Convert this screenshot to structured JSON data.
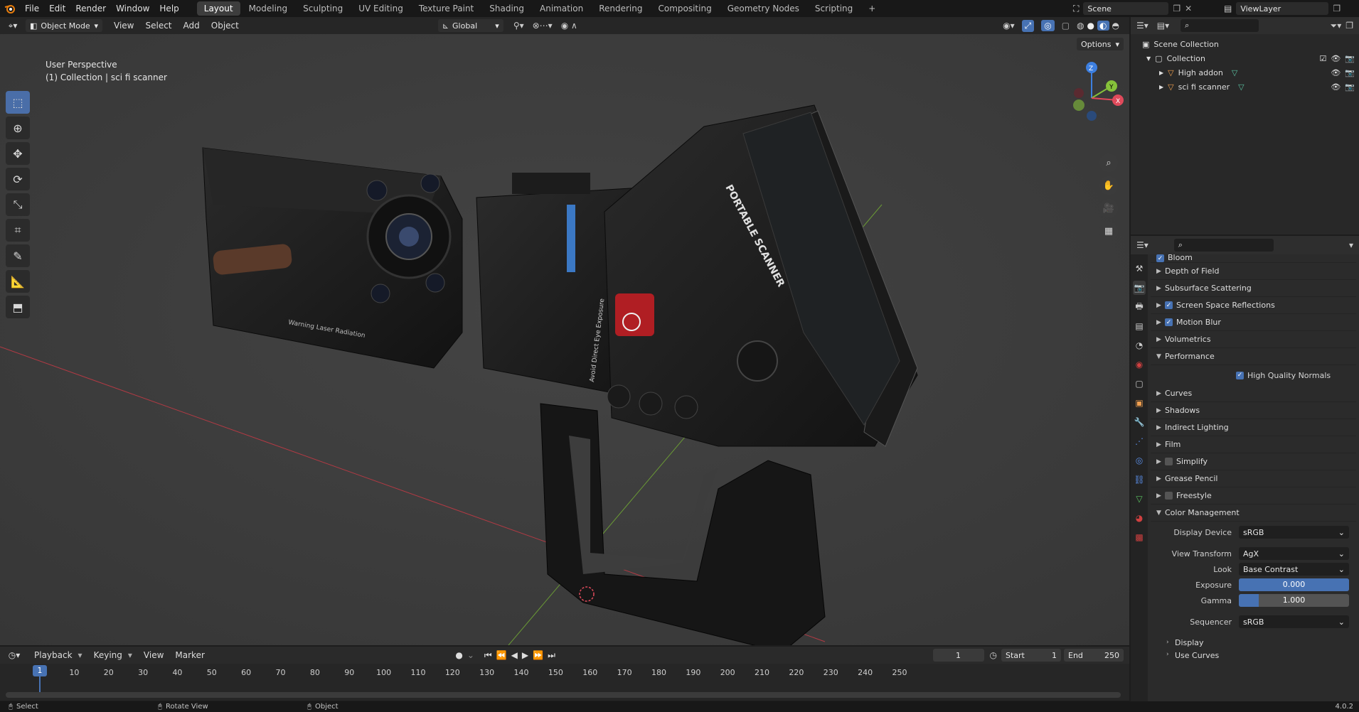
{
  "topbar": {
    "menus": [
      "File",
      "Edit",
      "Render",
      "Window",
      "Help"
    ],
    "workspaces": [
      "Layout",
      "Modeling",
      "Sculpting",
      "UV Editing",
      "Texture Paint",
      "Shading",
      "Animation",
      "Rendering",
      "Compositing",
      "Geometry Nodes",
      "Scripting"
    ],
    "active_workspace": "Layout",
    "add_tab": "+",
    "scene": "Scene",
    "view_layer": "ViewLayer"
  },
  "viewport_header": {
    "mode": "Object Mode",
    "menus": [
      "View",
      "Select",
      "Add",
      "Object"
    ],
    "orientation": "Global",
    "options": "Options"
  },
  "viewport": {
    "perspective": "User Perspective",
    "collection_info": "(1) Collection | sci fi scanner",
    "axes": {
      "x": "X",
      "y": "Y",
      "z": "Z"
    },
    "model": {
      "brand_text": "PORTABLE SCANNER",
      "side_text": "Avoid Direct Eye Exposure",
      "warning_text": "Warning Laser Radiation"
    }
  },
  "outliner": {
    "root": "Scene Collection",
    "collection": "Collection",
    "items": [
      {
        "label": "High addon"
      },
      {
        "label": "sci fi scanner"
      }
    ]
  },
  "properties": {
    "partial_top": "Bloom",
    "panels": [
      {
        "label": "Depth of Field",
        "checkbox": null
      },
      {
        "label": "Subsurface Scattering",
        "checkbox": null
      },
      {
        "label": "Screen Space Reflections",
        "checkbox": true
      },
      {
        "label": "Motion Blur",
        "checkbox": true
      },
      {
        "label": "Volumetrics",
        "checkbox": null
      }
    ],
    "performance": {
      "label": "Performance",
      "option": "High Quality Normals"
    },
    "panels2": [
      {
        "label": "Curves",
        "checkbox": null
      },
      {
        "label": "Shadows",
        "checkbox": null
      },
      {
        "label": "Indirect Lighting",
        "checkbox": null
      },
      {
        "label": "Film",
        "checkbox": null
      },
      {
        "label": "Simplify",
        "checkbox": false
      },
      {
        "label": "Grease Pencil",
        "checkbox": null
      },
      {
        "label": "Freestyle",
        "checkbox": false
      }
    ],
    "color_management": {
      "label": "Color Management",
      "display_device_label": "Display Device",
      "display_device": "sRGB",
      "view_transform_label": "View Transform",
      "view_transform": "AgX",
      "look_label": "Look",
      "look": "Base Contrast",
      "exposure_label": "Exposure",
      "exposure": "0.000",
      "gamma_label": "Gamma",
      "gamma": "1.000",
      "sequencer_label": "Sequencer",
      "sequencer": "sRGB",
      "display": "Display",
      "use_curves": "Use Curves"
    }
  },
  "timeline": {
    "menus": [
      "Playback",
      "Keying",
      "View",
      "Marker"
    ],
    "current_frame": "1",
    "start_label": "Start",
    "start": "1",
    "end_label": "End",
    "end": "250",
    "ticks": [
      "10",
      "20",
      "30",
      "40",
      "50",
      "60",
      "70",
      "80",
      "90",
      "100",
      "110",
      "120",
      "130",
      "140",
      "150",
      "160",
      "170",
      "180",
      "190",
      "200",
      "210",
      "220",
      "230",
      "240",
      "250"
    ],
    "playhead": "1"
  },
  "statusbar": {
    "select": "Select",
    "rotate": "Rotate View",
    "object": "Object",
    "version": "4.0.2"
  },
  "colors": {
    "accent": "#4772b3",
    "axis_x": "#e04a5b",
    "axis_y": "#86c23a",
    "axis_z": "#3d7fe0",
    "viewport_bg": "#3d3d3d"
  }
}
